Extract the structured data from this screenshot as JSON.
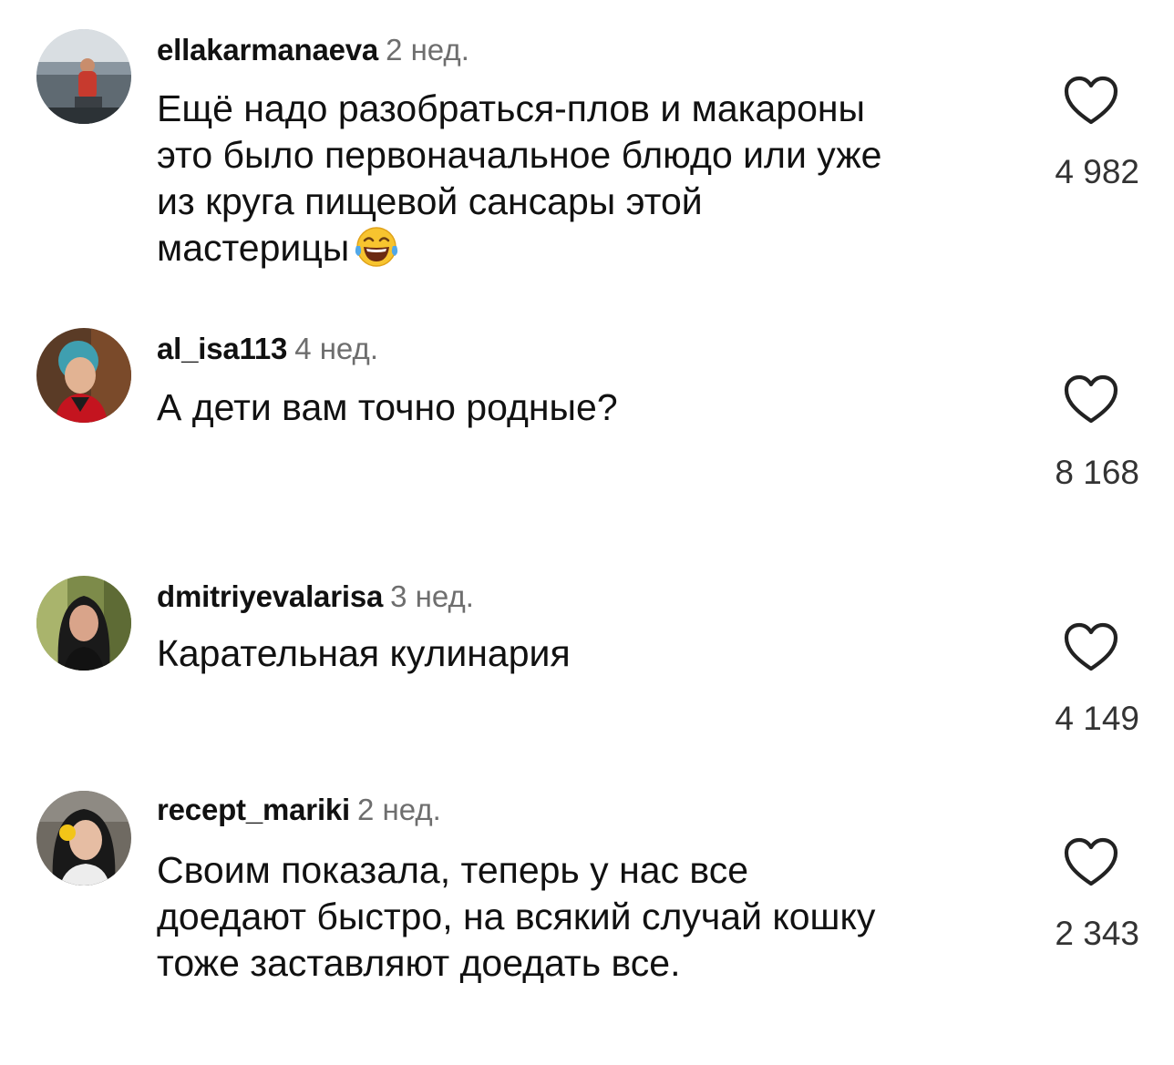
{
  "comments": [
    {
      "username": "ellakarmanaeva",
      "time": "2 нед.",
      "text_lines": [
        "Ещё надо разобраться-плов и макароны",
        "это было первоначальное блюдо или уже",
        "из круга пищевой сансары этой",
        "мастерицы"
      ],
      "emoji": "face-with-tears-of-joy",
      "likes": "4 982"
    },
    {
      "username": "al_isa113",
      "time": "4 нед.",
      "text_lines": [
        "А дети вам точно родные?"
      ],
      "likes": "8 168"
    },
    {
      "username": "dmitriyevalarisa",
      "time": "3 нед.",
      "text_lines": [
        "Карательная кулинария"
      ],
      "likes": "4 149"
    },
    {
      "username": "recept_mariki",
      "time": "2 нед.",
      "text_lines": [
        "Своим показала, теперь у нас все",
        "доедают быстро, на всякий случай кошку",
        "тоже заставляют доедать все."
      ],
      "likes": "2 343"
    }
  ],
  "icons": {
    "like": "heart-outline-icon"
  },
  "colors": {
    "text": "#111111",
    "meta": "#6e6e6e",
    "count": "#333333",
    "background": "#ffffff"
  }
}
